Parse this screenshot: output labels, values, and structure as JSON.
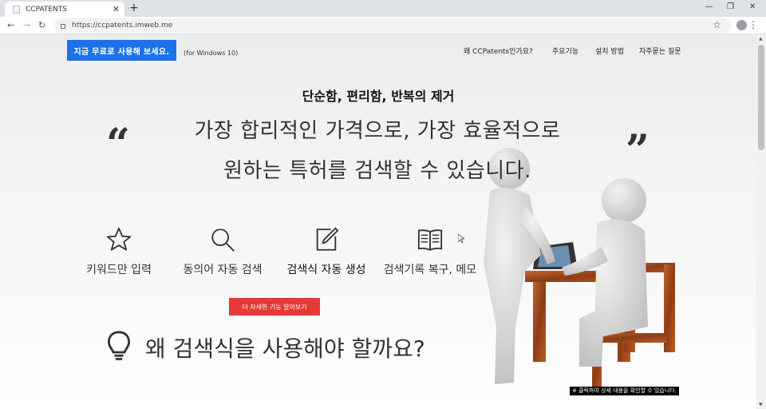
{
  "browser": {
    "tab_title": "CCPATENTS",
    "url": "https://ccpatents.imweb.me"
  },
  "header": {
    "cta_label": "지금 무료로 사용해 보세요.",
    "platform_note": "(for Windows 10)",
    "nav": [
      "왜 CCPatents인가요?",
      "주요기능",
      "설치 방법",
      "자주묻는 질문"
    ]
  },
  "hero": {
    "tagline": "단순함, 편리함, 반복의 제거",
    "headline_line1": "가장 합리적인 가격으로, 가장 효율적으로",
    "headline_line2": "원하는 특허를 검색할 수 있습니다."
  },
  "features": [
    {
      "label": "키워드만 입력",
      "icon": "star-icon"
    },
    {
      "label": "동의어 자동 검색",
      "icon": "magnifier-icon"
    },
    {
      "label": "검색식 자동 생성",
      "icon": "edit-icon"
    },
    {
      "label": "검색기록 복구, 메모",
      "icon": "book-icon"
    }
  ],
  "detail_button": "더 자세한 기능 알아보기",
  "why_heading": "왜 검색식을 사용해야 할까요?",
  "notice": "※ 클릭하여 상세 내용을 확인할 수 있습니다.",
  "colors": {
    "cta_blue": "#1a73e8",
    "detail_red": "#e53935",
    "text_dark": "#333333"
  }
}
